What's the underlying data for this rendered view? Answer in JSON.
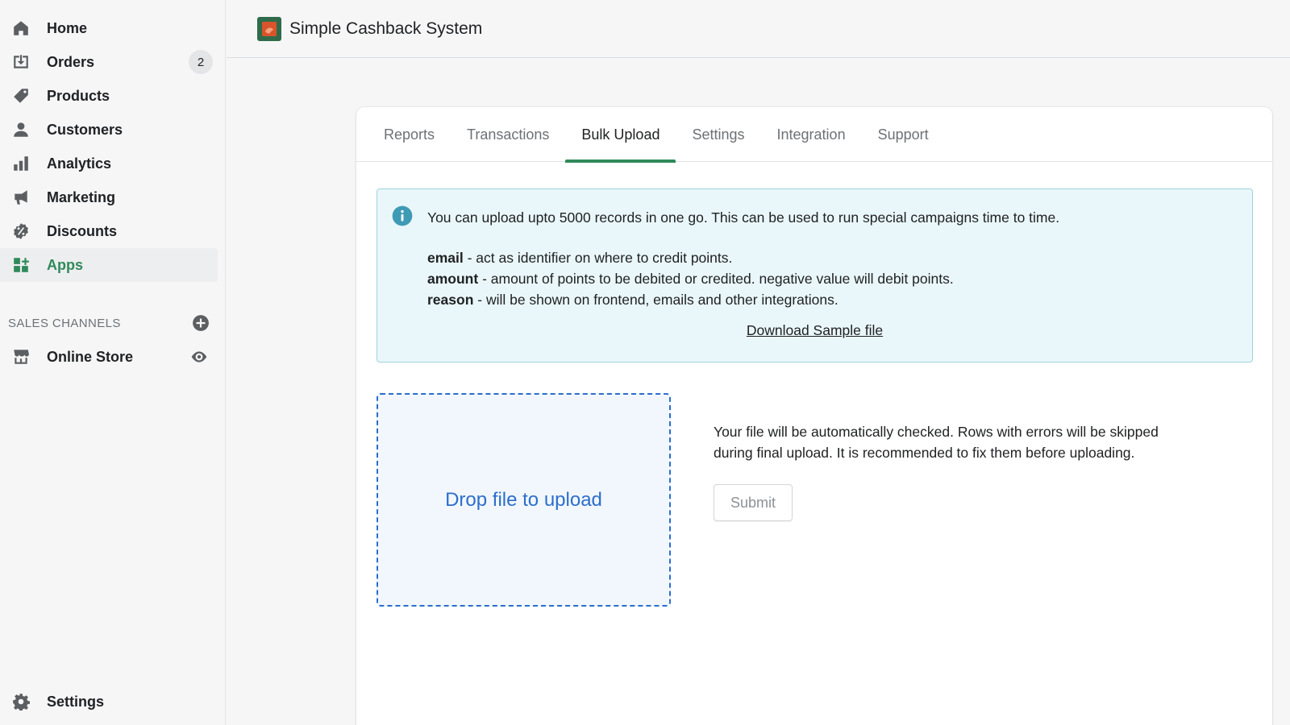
{
  "sidebar": {
    "items": [
      {
        "label": "Home",
        "icon": "home-icon"
      },
      {
        "label": "Orders",
        "icon": "orders-icon",
        "badge": "2"
      },
      {
        "label": "Products",
        "icon": "tag-icon"
      },
      {
        "label": "Customers",
        "icon": "person-icon"
      },
      {
        "label": "Analytics",
        "icon": "bar-chart-icon"
      },
      {
        "label": "Marketing",
        "icon": "megaphone-icon"
      },
      {
        "label": "Discounts",
        "icon": "discount-icon"
      },
      {
        "label": "Apps",
        "icon": "apps-icon",
        "active": true
      }
    ],
    "sales_channels": {
      "title": "SALES CHANNELS",
      "online_store": "Online Store"
    },
    "settings": "Settings"
  },
  "topbar": {
    "app_title": "Simple Cashback System"
  },
  "tabs": [
    "Reports",
    "Transactions",
    "Bulk Upload",
    "Settings",
    "Integration",
    "Support"
  ],
  "active_tab": "Bulk Upload",
  "info": {
    "text": "You can upload upto 5000 records in one go. This can be used to run special campaigns time to time.",
    "fields": [
      {
        "key": "email",
        "desc": " - act as identifier on where to credit points."
      },
      {
        "key": "amount",
        "desc": " - amount of points to be debited or credited. negative value will debit points."
      },
      {
        "key": "reason",
        "desc": " - will be shown on frontend, emails and other integrations."
      }
    ],
    "download_link": "Download Sample file"
  },
  "upload": {
    "dropzone_label": "Drop file to upload",
    "hint": "Your file will be automatically checked. Rows with errors will be skipped during final upload. It is recommended to fix them before uploading.",
    "submit_label": "Submit"
  },
  "colors": {
    "accent": "#2f8a5b",
    "link_blue": "#2c6ecb",
    "info_bg": "#eaf7fa",
    "info_border": "#9ed3df"
  }
}
